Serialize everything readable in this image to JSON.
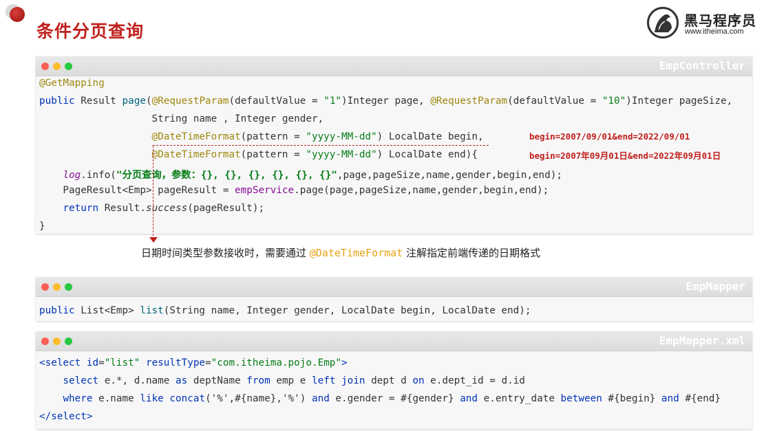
{
  "slide": {
    "title": "条件分页查询",
    "logo": {
      "name": "黑马程序员",
      "url": "www.itheima.com"
    }
  },
  "controller": {
    "file": "EmpController",
    "lines": [
      [
        "@GetMapping"
      ],
      [
        "public",
        " Result ",
        "page",
        "(",
        "@RequestParam",
        "(defaultValue = ",
        "\"1\"",
        ")Integer page, ",
        "@RequestParam",
        "(defaultValue = ",
        "\"10\"",
        ")Integer pageSize,"
      ],
      [
        "                   String name , Integer gender,"
      ],
      [
        "                   ",
        "@DateTimeFormat",
        "(pattern = ",
        "\"yyyy-MM-dd\"",
        ") LocalDate begin,"
      ],
      [
        "                   ",
        "@DateTimeFormat",
        "(pattern = ",
        "\"yyyy-MM-dd\"",
        ") LocalDate end){"
      ],
      [
        "    ",
        "log",
        ".info(",
        "\"分页查询，参数：{}, {}, {}, {}, {}, {}\"",
        ",page,pageSize,name,gender,begin,end);"
      ],
      [
        "    PageResult<Emp> pageResult = ",
        "empService",
        ".page(page,pageSize,name,gender,begin,end);"
      ],
      [
        "    ",
        "return",
        " Result.",
        "success",
        "(pageResult);"
      ],
      [
        "}"
      ]
    ],
    "notes": [
      "begin=2007/09/01&end=2022/09/01",
      "begin=2007年09月01日&end=2022年09月01日"
    ]
  },
  "caption": {
    "before": "日期时间类型参数接收时，需要通过 ",
    "annotation": "@DateTimeFormat",
    "after": " 注解指定前端传递的日期格式"
  },
  "mapper": {
    "file": "EmpMapper",
    "line": [
      "public",
      " List<Emp> ",
      "list",
      "(String name, Integer gender, LocalDate begin, LocalDate end);"
    ]
  },
  "xml": {
    "file": "EmpMapper.xml",
    "lines": [
      [
        "<select ",
        "id",
        "=",
        "\"list\"",
        " ",
        "resultType",
        "=",
        "\"com.itheima.pojo.Emp\"",
        ">"
      ],
      [
        "    ",
        "select",
        " e.*, d.name ",
        "as",
        " deptName ",
        "from",
        " emp e ",
        "left join",
        " dept d ",
        "on",
        " e.dept_id = d.id"
      ],
      [
        "    ",
        "where",
        " e.name ",
        "like",
        " ",
        "concat",
        "('%',#{name},'%') ",
        "and",
        " e.gender = #{gender} ",
        "and",
        " e.entry_date ",
        "between",
        " #{begin} ",
        "and",
        " #{end}"
      ],
      [
        "</select>"
      ]
    ]
  },
  "colors": {
    "accent": "#c0201c",
    "annotation": "#9e880d",
    "keyword": "#0033b3",
    "string": "#067d17"
  }
}
